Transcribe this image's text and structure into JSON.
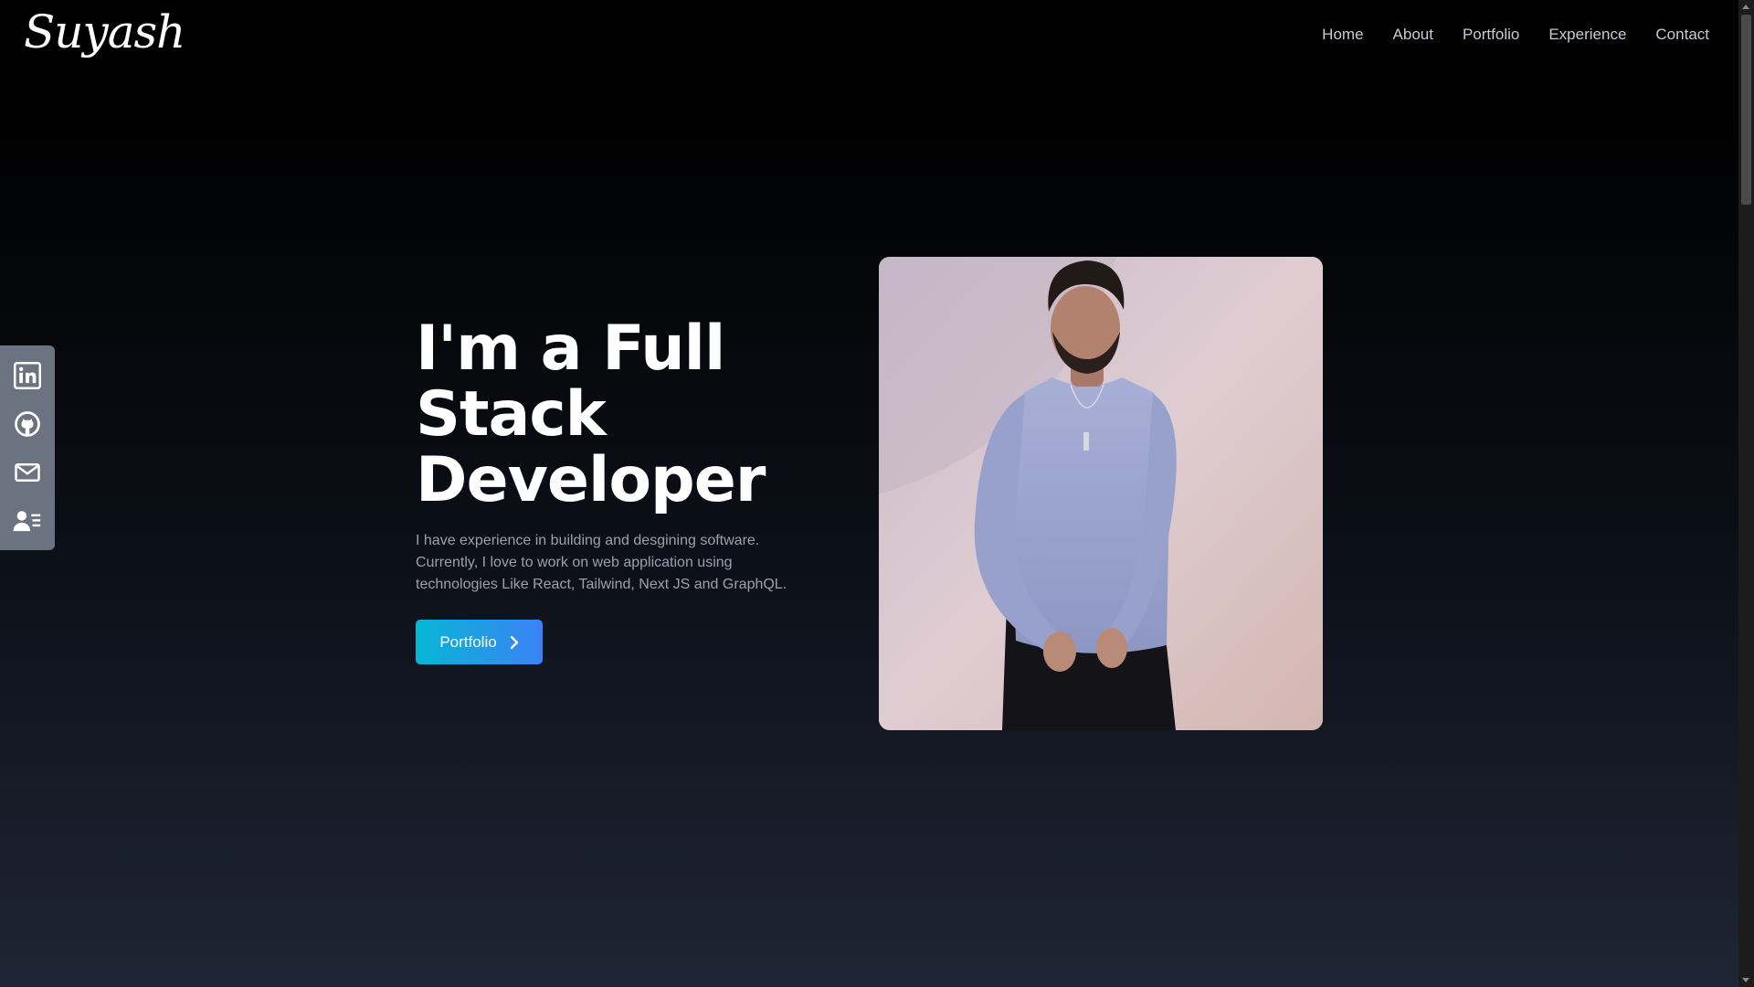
{
  "header": {
    "logo": "Suyash",
    "nav": [
      {
        "label": "Home"
      },
      {
        "label": "About"
      },
      {
        "label": "Portfolio"
      },
      {
        "label": "Experience"
      },
      {
        "label": "Contact"
      }
    ]
  },
  "social": [
    {
      "icon": "linkedin-icon"
    },
    {
      "icon": "github-icon"
    },
    {
      "icon": "mail-icon"
    },
    {
      "icon": "resume-icon"
    }
  ],
  "hero": {
    "title_line1": "I'm a Full",
    "title_line2": "Stack",
    "title_line3": "Developer",
    "description": "I have experience in building and desgining software. Currently, I love to work on web application using technologies Like React, Tailwind, Next JS and GraphQL.",
    "cta_label": "Portfolio",
    "cta_icon": "chevron-right-icon"
  },
  "colors": {
    "cta_start": "#06b6d4",
    "cta_end": "#3b82f6",
    "sidebar": "#6b7280"
  }
}
